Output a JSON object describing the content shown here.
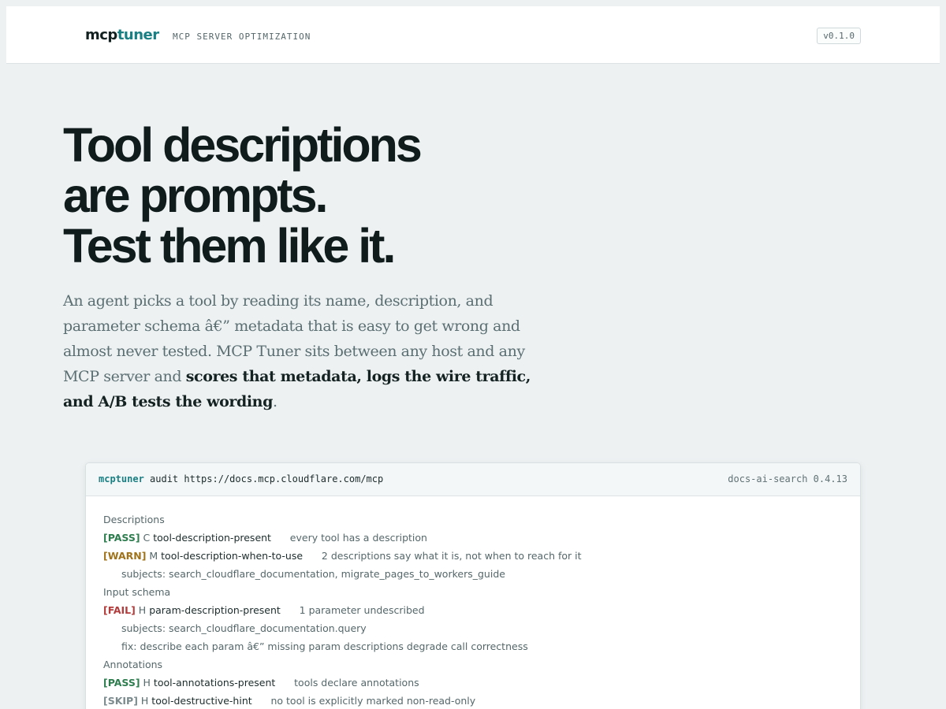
{
  "header": {
    "logo_left": "mcp",
    "logo_right": "tuner",
    "tagline": "MCP SERVER OPTIMIZATION",
    "version": "v0.1.0"
  },
  "hero": {
    "title_lines": [
      "Tool descriptions",
      "are prompts.",
      "Test them like it."
    ],
    "desc_plain": "An agent picks a tool by reading its name, description, and parameter schema â€” metadata that is easy to get wrong and almost never tested. MCP Tuner sits between any host and any MCP server and ",
    "desc_bold": "scores that metadata, logs the wire traffic, and A/B tests the wording",
    "desc_end": "."
  },
  "terminal": {
    "command_bin": "mcptuner",
    "command_rest": " audit https://docs.mcp.cloudflare.com/mcp",
    "server": "docs-ai-search 0.4.13",
    "lines": [
      {
        "kind": "section",
        "text": "Descriptions"
      },
      {
        "kind": "check",
        "status": "[PASS]",
        "cls": "pass",
        "sev": "C",
        "rule": "tool-description-present",
        "msg": "every tool has a description"
      },
      {
        "kind": "check",
        "status": "[WARN]",
        "cls": "warn",
        "sev": "M",
        "rule": "tool-description-when-to-use",
        "msg": "2 descriptions say what it is, not when to reach for it"
      },
      {
        "kind": "indent",
        "text": "subjects: search_cloudflare_documentation, migrate_pages_to_workers_guide"
      },
      {
        "kind": "section",
        "text": "Input schema"
      },
      {
        "kind": "check",
        "status": "[FAIL]",
        "cls": "fail",
        "sev": "H",
        "rule": "param-description-present",
        "msg": "1 parameter undescribed"
      },
      {
        "kind": "indent",
        "text": "subjects: search_cloudflare_documentation.query"
      },
      {
        "kind": "indent",
        "text": "fix: describe each param â€” missing param descriptions degrade call correctness"
      },
      {
        "kind": "section",
        "text": "Annotations"
      },
      {
        "kind": "check",
        "status": "[PASS]",
        "cls": "pass",
        "sev": "H",
        "rule": "tool-annotations-present",
        "msg": "tools declare annotations"
      },
      {
        "kind": "check",
        "status": "[SKIP]",
        "cls": "skip",
        "sev": "H",
        "rule": "tool-destructive-hint",
        "msg": "no tool is explicitly marked non-read-only"
      }
    ]
  },
  "colors": {
    "accent": "#1a7f83",
    "pass": "#2e7d4f",
    "warn": "#a0731b",
    "fail": "#b23b3b",
    "skip": "#7b8a8d"
  }
}
